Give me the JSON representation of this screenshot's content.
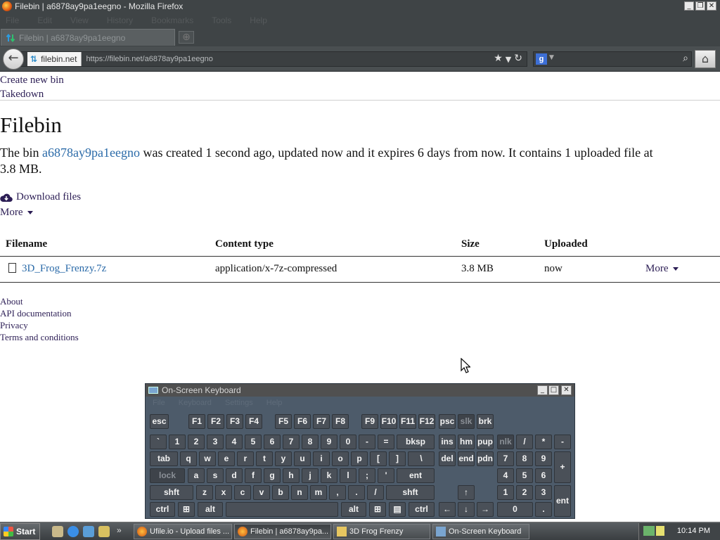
{
  "window": {
    "title": "Filebin | a6878ay9pa1eegno - Mozilla Firefox"
  },
  "menu": [
    "File",
    "Edit",
    "View",
    "History",
    "Bookmarks",
    "Tools",
    "Help"
  ],
  "tab": {
    "label": "Filebin | a6878ay9pa1eegno"
  },
  "urlbar": {
    "identity": "filebin.net",
    "url": "https://filebin.net/a6878ay9pa1eegno"
  },
  "search": {
    "placeholder": ""
  },
  "page": {
    "nav": {
      "create": "Create new bin",
      "takedown": "Takedown"
    },
    "title": "Filebin",
    "desc": {
      "prefix": "The bin ",
      "bin_id": "a6878ay9pa1eegno",
      "middle": " was created 1 second ago, updated now and it expires 6 days from now. It contains 1 uploaded file at",
      "line2": "3.8 MB."
    },
    "download_label": "Download files",
    "more_label": "More",
    "table": {
      "headers": [
        "Filename",
        "Content type",
        "Size",
        "Uploaded"
      ],
      "rows": [
        {
          "filename": "3D_Frog_Frenzy.7z",
          "content_type": "application/x-7z-compressed",
          "size": "3.8 MB",
          "uploaded": "now",
          "more": "More"
        }
      ]
    },
    "footer": {
      "about": "About",
      "api": "API documentation",
      "privacy": "Privacy",
      "terms": "Terms and conditions"
    }
  },
  "osk": {
    "title": "On-Screen Keyboard",
    "menu": [
      "File",
      "Keyboard",
      "Settings",
      "Help"
    ]
  },
  "taskbar": {
    "start": "Start",
    "buttons": [
      "Ufile.io - Upload files ...",
      "Filebin | a6878ay9pa...",
      "3D Frog Frenzy",
      "On-Screen Keyboard"
    ],
    "clock": "10:14 PM"
  }
}
